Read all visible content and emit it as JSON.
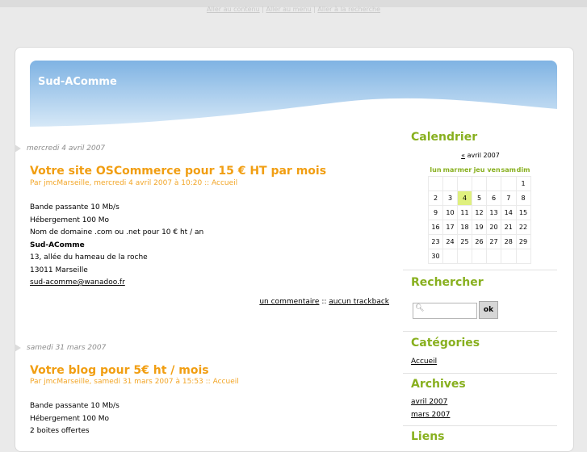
{
  "skip_links": {
    "content": "Aller au contenu",
    "menu": "Aller au menu",
    "search": "Aller à la recherche",
    "separator": "|"
  },
  "site": {
    "title": "Sud-AComme"
  },
  "posts": [
    {
      "date": "mercredi 4 avril 2007",
      "title": "Votre site OSCommerce pour 15 € HT par mois",
      "info_prefix": "Par jmcMarseille, mercredi 4 avril 2007 à 10:20 ::",
      "category": "Accueil",
      "lines": [
        "Bande passante 10 Mb/s",
        "Hébergement 100 Mo",
        "Nom de domaine .com ou .net pour 10 € ht / an",
        "Sud-AComme",
        "13, allée du hameau de la roche",
        "13011 Marseille",
        "sud-acomme@wanadoo.fr"
      ],
      "comments": "un commentaire",
      "footer_sep": "::",
      "trackbacks": "aucun trackback"
    },
    {
      "date": "samedi 31 mars 2007",
      "title": "Votre blog pour 5€ ht / mois",
      "info_prefix": "Par jmcMarseille, samedi 31 mars 2007 à 15:53 ::",
      "category": "Accueil",
      "lines": [
        "Bande passante 10 Mb/s",
        "Hébergement 100 Mo",
        "2 boites offertes"
      ]
    }
  ],
  "sidebar": {
    "calendar": {
      "title": "Calendrier",
      "prev": "«",
      "month": "avril 2007",
      "weekdays": [
        "lun",
        "mar",
        "mer",
        "jeu",
        "ven",
        "sam",
        "dim"
      ],
      "weeks": [
        [
          "",
          "",
          "",
          "",
          "",
          "",
          "1"
        ],
        [
          "2",
          "3",
          "4",
          "5",
          "6",
          "7",
          "8"
        ],
        [
          "9",
          "10",
          "11",
          "12",
          "13",
          "14",
          "15"
        ],
        [
          "16",
          "17",
          "18",
          "19",
          "20",
          "21",
          "22"
        ],
        [
          "23",
          "24",
          "25",
          "26",
          "27",
          "28",
          "29"
        ],
        [
          "30",
          "",
          "",
          "",
          "",
          "",
          ""
        ]
      ],
      "today": "4"
    },
    "search": {
      "title": "Rechercher",
      "button": "ok",
      "value": ""
    },
    "categories": {
      "title": "Catégories",
      "items": [
        "Accueil"
      ]
    },
    "archives": {
      "title": "Archives",
      "items": [
        "avril 2007",
        "mars 2007"
      ]
    },
    "links": {
      "title": "Liens"
    }
  },
  "colors": {
    "accent_orange": "#f19e12",
    "accent_green": "#88b01f",
    "header_blue": "#8fbfe8",
    "today_highlight": "#dff07e"
  }
}
